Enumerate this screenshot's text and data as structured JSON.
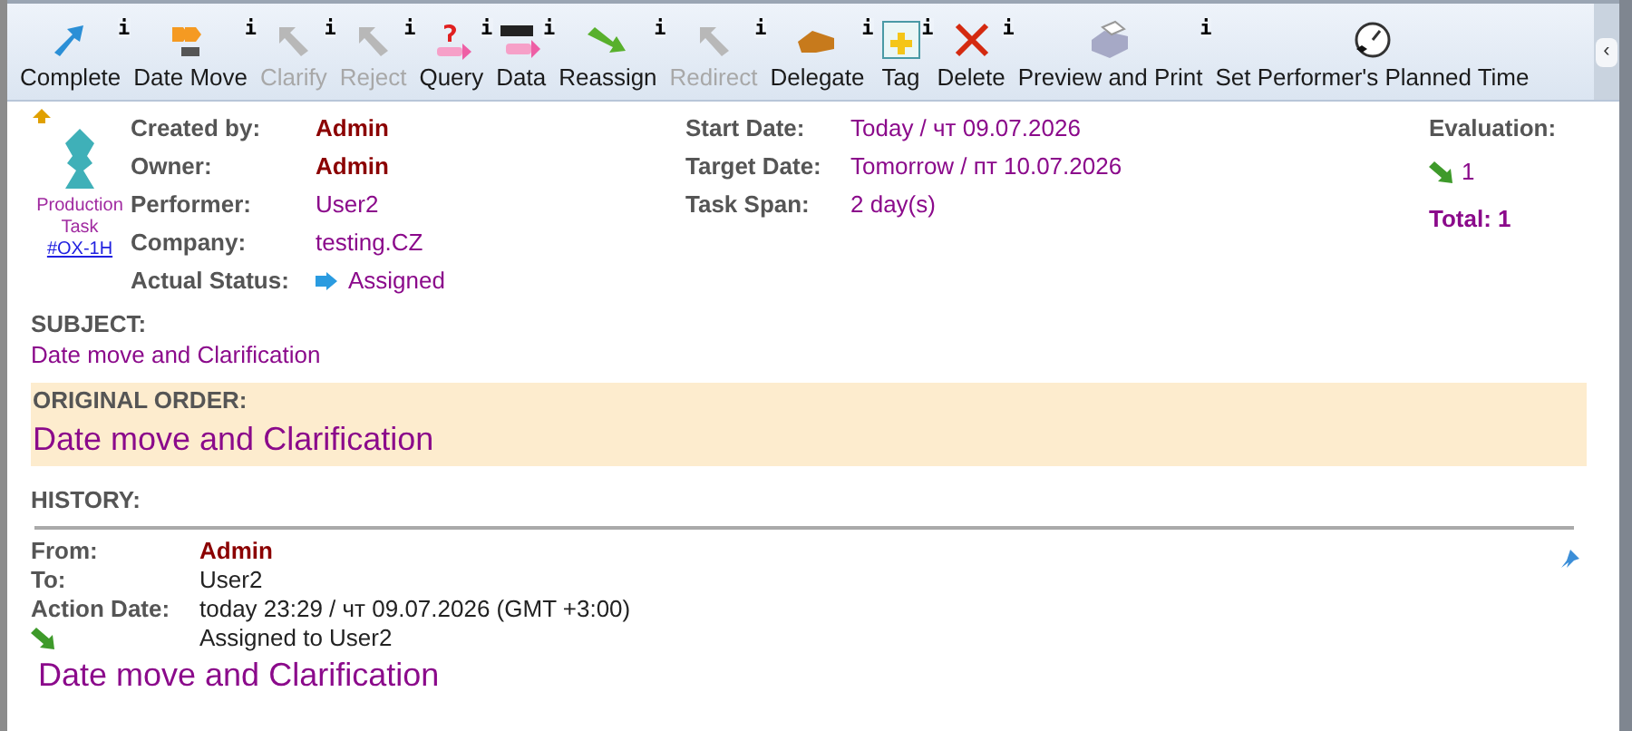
{
  "toolbar": {
    "buttons": [
      {
        "label": "Complete",
        "kind": "complete",
        "disabled": false,
        "info": "i"
      },
      {
        "label": "Date Move",
        "kind": "datemove",
        "disabled": false,
        "info": "i"
      },
      {
        "label": "Clarify",
        "kind": "clarify",
        "disabled": true,
        "info": "i"
      },
      {
        "label": "Reject",
        "kind": "reject",
        "disabled": true,
        "info": "i"
      },
      {
        "label": "Query",
        "kind": "query",
        "disabled": false,
        "info": "i"
      },
      {
        "label": "Data",
        "kind": "data",
        "disabled": false,
        "info": "i"
      },
      {
        "label": "Reassign",
        "kind": "reassign",
        "disabled": false,
        "info": "i"
      },
      {
        "label": "Redirect",
        "kind": "redirect",
        "disabled": true,
        "info": "i"
      },
      {
        "label": "Delegate",
        "kind": "delegate",
        "disabled": false,
        "info": "i"
      },
      {
        "label": "Tag",
        "kind": "tag",
        "disabled": false,
        "info": "i"
      },
      {
        "label": "Delete",
        "kind": "delete",
        "disabled": false,
        "info": "i"
      },
      {
        "label": "Preview and Print",
        "kind": "print",
        "disabled": false,
        "info": "i"
      },
      {
        "label": "Set Performer's Planned Time",
        "kind": "clock",
        "disabled": false
      }
    ],
    "scroll_button": "‹"
  },
  "task": {
    "type_label": "Production Task",
    "code": "#OX-1H"
  },
  "fields": [
    {
      "label": "Created by:",
      "value": "Admin",
      "kind": "user"
    },
    {
      "label": "Owner:",
      "value": "Admin",
      "kind": "user"
    },
    {
      "label": "Performer:",
      "value": "User2",
      "kind": "plain"
    },
    {
      "label": "Company:",
      "value": "testing.CZ",
      "kind": "plain"
    },
    {
      "label": "Actual Status:",
      "value": "Assigned",
      "kind": "status"
    }
  ],
  "dates": [
    {
      "label": "Start Date:",
      "value": "Today / чт 09.07.2026"
    },
    {
      "label": "Target Date:",
      "value": "Tomorrow / пт 10.07.2026"
    },
    {
      "label": "Task Span:",
      "value": "2 day(s)"
    }
  ],
  "evaluation": {
    "title": "Evaluation:",
    "count": "1",
    "total": "Total: 1"
  },
  "subject": {
    "title": "SUBJECT:",
    "text": "Date move and Clarification"
  },
  "original_order": {
    "title": "ORIGINAL ORDER:",
    "text": "Date move and Clarification"
  },
  "history": {
    "title": "HISTORY:",
    "entries": [
      {
        "from_label": "From:",
        "from": "Admin",
        "to_label": "To:",
        "to": "User2",
        "date_label": "Action Date:",
        "date": "today 23:29 / чт 09.07.2026 (GMT +3:00)",
        "action": "Assigned to User2",
        "text": "Date move and Clarification"
      }
    ]
  }
}
